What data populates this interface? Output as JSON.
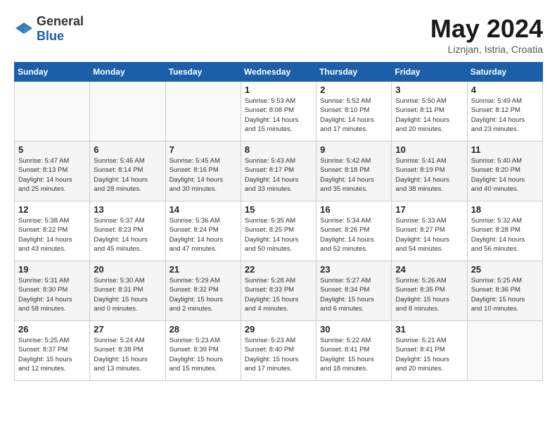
{
  "header": {
    "logo_general": "General",
    "logo_blue": "Blue",
    "month_title": "May 2024",
    "location": "Liznjan, Istria, Croatia"
  },
  "weekdays": [
    "Sunday",
    "Monday",
    "Tuesday",
    "Wednesday",
    "Thursday",
    "Friday",
    "Saturday"
  ],
  "weeks": [
    [
      {
        "day": "",
        "lines": []
      },
      {
        "day": "",
        "lines": []
      },
      {
        "day": "",
        "lines": []
      },
      {
        "day": "1",
        "lines": [
          "Sunrise: 5:53 AM",
          "Sunset: 8:08 PM",
          "Daylight: 14 hours",
          "and 15 minutes."
        ]
      },
      {
        "day": "2",
        "lines": [
          "Sunrise: 5:52 AM",
          "Sunset: 8:10 PM",
          "Daylight: 14 hours",
          "and 17 minutes."
        ]
      },
      {
        "day": "3",
        "lines": [
          "Sunrise: 5:50 AM",
          "Sunset: 8:11 PM",
          "Daylight: 14 hours",
          "and 20 minutes."
        ]
      },
      {
        "day": "4",
        "lines": [
          "Sunrise: 5:49 AM",
          "Sunset: 8:12 PM",
          "Daylight: 14 hours",
          "and 23 minutes."
        ]
      }
    ],
    [
      {
        "day": "5",
        "lines": [
          "Sunrise: 5:47 AM",
          "Sunset: 8:13 PM",
          "Daylight: 14 hours",
          "and 25 minutes."
        ]
      },
      {
        "day": "6",
        "lines": [
          "Sunrise: 5:46 AM",
          "Sunset: 8:14 PM",
          "Daylight: 14 hours",
          "and 28 minutes."
        ]
      },
      {
        "day": "7",
        "lines": [
          "Sunrise: 5:45 AM",
          "Sunset: 8:16 PM",
          "Daylight: 14 hours",
          "and 30 minutes."
        ]
      },
      {
        "day": "8",
        "lines": [
          "Sunrise: 5:43 AM",
          "Sunset: 8:17 PM",
          "Daylight: 14 hours",
          "and 33 minutes."
        ]
      },
      {
        "day": "9",
        "lines": [
          "Sunrise: 5:42 AM",
          "Sunset: 8:18 PM",
          "Daylight: 14 hours",
          "and 35 minutes."
        ]
      },
      {
        "day": "10",
        "lines": [
          "Sunrise: 5:41 AM",
          "Sunset: 8:19 PM",
          "Daylight: 14 hours",
          "and 38 minutes."
        ]
      },
      {
        "day": "11",
        "lines": [
          "Sunrise: 5:40 AM",
          "Sunset: 8:20 PM",
          "Daylight: 14 hours",
          "and 40 minutes."
        ]
      }
    ],
    [
      {
        "day": "12",
        "lines": [
          "Sunrise: 5:38 AM",
          "Sunset: 8:22 PM",
          "Daylight: 14 hours",
          "and 43 minutes."
        ]
      },
      {
        "day": "13",
        "lines": [
          "Sunrise: 5:37 AM",
          "Sunset: 8:23 PM",
          "Daylight: 14 hours",
          "and 45 minutes."
        ]
      },
      {
        "day": "14",
        "lines": [
          "Sunrise: 5:36 AM",
          "Sunset: 8:24 PM",
          "Daylight: 14 hours",
          "and 47 minutes."
        ]
      },
      {
        "day": "15",
        "lines": [
          "Sunrise: 5:35 AM",
          "Sunset: 8:25 PM",
          "Daylight: 14 hours",
          "and 50 minutes."
        ]
      },
      {
        "day": "16",
        "lines": [
          "Sunrise: 5:34 AM",
          "Sunset: 8:26 PM",
          "Daylight: 14 hours",
          "and 52 minutes."
        ]
      },
      {
        "day": "17",
        "lines": [
          "Sunrise: 5:33 AM",
          "Sunset: 8:27 PM",
          "Daylight: 14 hours",
          "and 54 minutes."
        ]
      },
      {
        "day": "18",
        "lines": [
          "Sunrise: 5:32 AM",
          "Sunset: 8:28 PM",
          "Daylight: 14 hours",
          "and 56 minutes."
        ]
      }
    ],
    [
      {
        "day": "19",
        "lines": [
          "Sunrise: 5:31 AM",
          "Sunset: 8:30 PM",
          "Daylight: 14 hours",
          "and 58 minutes."
        ]
      },
      {
        "day": "20",
        "lines": [
          "Sunrise: 5:30 AM",
          "Sunset: 8:31 PM",
          "Daylight: 15 hours",
          "and 0 minutes."
        ]
      },
      {
        "day": "21",
        "lines": [
          "Sunrise: 5:29 AM",
          "Sunset: 8:32 PM",
          "Daylight: 15 hours",
          "and 2 minutes."
        ]
      },
      {
        "day": "22",
        "lines": [
          "Sunrise: 5:28 AM",
          "Sunset: 8:33 PM",
          "Daylight: 15 hours",
          "and 4 minutes."
        ]
      },
      {
        "day": "23",
        "lines": [
          "Sunrise: 5:27 AM",
          "Sunset: 8:34 PM",
          "Daylight: 15 hours",
          "and 6 minutes."
        ]
      },
      {
        "day": "24",
        "lines": [
          "Sunrise: 5:26 AM",
          "Sunset: 8:35 PM",
          "Daylight: 15 hours",
          "and 8 minutes."
        ]
      },
      {
        "day": "25",
        "lines": [
          "Sunrise: 5:25 AM",
          "Sunset: 8:36 PM",
          "Daylight: 15 hours",
          "and 10 minutes."
        ]
      }
    ],
    [
      {
        "day": "26",
        "lines": [
          "Sunrise: 5:25 AM",
          "Sunset: 8:37 PM",
          "Daylight: 15 hours",
          "and 12 minutes."
        ]
      },
      {
        "day": "27",
        "lines": [
          "Sunrise: 5:24 AM",
          "Sunset: 8:38 PM",
          "Daylight: 15 hours",
          "and 13 minutes."
        ]
      },
      {
        "day": "28",
        "lines": [
          "Sunrise: 5:23 AM",
          "Sunset: 8:39 PM",
          "Daylight: 15 hours",
          "and 15 minutes."
        ]
      },
      {
        "day": "29",
        "lines": [
          "Sunrise: 5:23 AM",
          "Sunset: 8:40 PM",
          "Daylight: 15 hours",
          "and 17 minutes."
        ]
      },
      {
        "day": "30",
        "lines": [
          "Sunrise: 5:22 AM",
          "Sunset: 8:41 PM",
          "Daylight: 15 hours",
          "and 18 minutes."
        ]
      },
      {
        "day": "31",
        "lines": [
          "Sunrise: 5:21 AM",
          "Sunset: 8:41 PM",
          "Daylight: 15 hours",
          "and 20 minutes."
        ]
      },
      {
        "day": "",
        "lines": []
      }
    ]
  ]
}
